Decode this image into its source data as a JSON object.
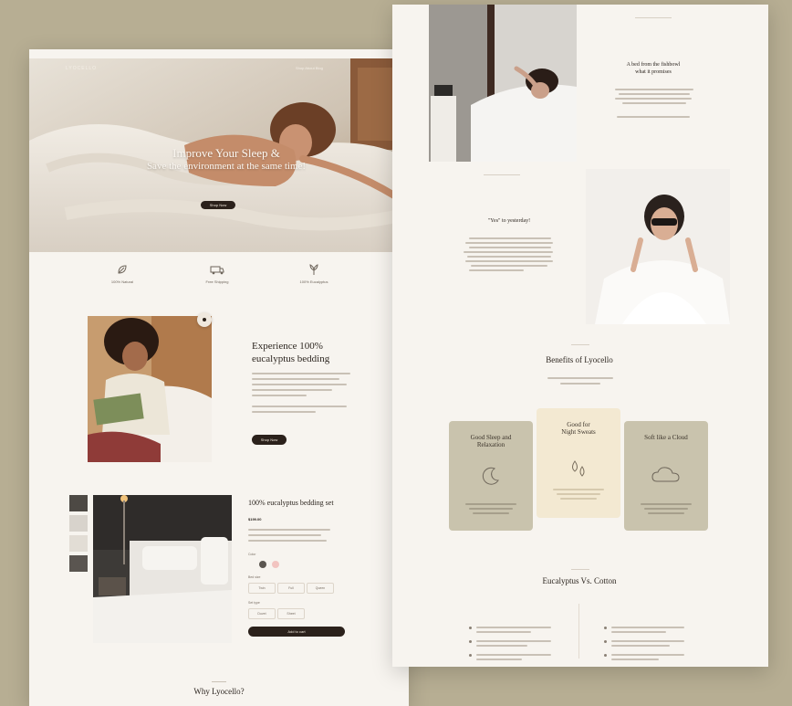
{
  "hero": {
    "title_line1": "Improve Your Sleep &",
    "title_line2": "Save the environment at the same time!",
    "cta": "Shop Now",
    "brand": "LYOCELLO",
    "nav": "Shop   About   Blog"
  },
  "features": [
    {
      "icon": "leaf-icon",
      "label": "100% Natural"
    },
    {
      "icon": "truck-icon",
      "label": "Free Shipping"
    },
    {
      "icon": "plant-icon",
      "label": "100% Eucalyptus"
    }
  ],
  "experience": {
    "title_line1": "Experience 100%",
    "title_line2": "eucalyptus bedding",
    "cta": "Shop Now"
  },
  "product": {
    "title": "100% eucalyptus bedding set",
    "price": "$199.00",
    "color_label": "Color",
    "size_label": "Bed size",
    "sizes": [
      "Twin",
      "Full",
      "Queen"
    ],
    "sets_label": "Set type",
    "sets": [
      "Duvet",
      "Sheet"
    ],
    "cta": "Add to cart"
  },
  "why": {
    "title": "Why Lyocello?"
  },
  "right": {
    "intro_title_line1": "A bed from the fishbowl",
    "intro_title_line2": "what it promises",
    "yes_title": "\"Yes\" to yesterday!",
    "benefits_title": "Benefits of Lyocello",
    "cards": [
      {
        "title_line1": "Good Sleep and",
        "title_line2": "Relaxation",
        "icon": "moon-icon"
      },
      {
        "title_line1": "Good for",
        "title_line2": "Night Sweats",
        "icon": "drops-icon"
      },
      {
        "title_line1": "Soft like a Cloud",
        "title_line2": "",
        "icon": "cloud-icon"
      }
    ],
    "compare_title": "Eucalyptus Vs. Cotton"
  },
  "colors": {
    "page": "#f7f4ef",
    "dark": "#2b211b",
    "card_sage": "#c9c3ad",
    "card_cream": "#f3e9d2",
    "background": "#b7ae93"
  }
}
